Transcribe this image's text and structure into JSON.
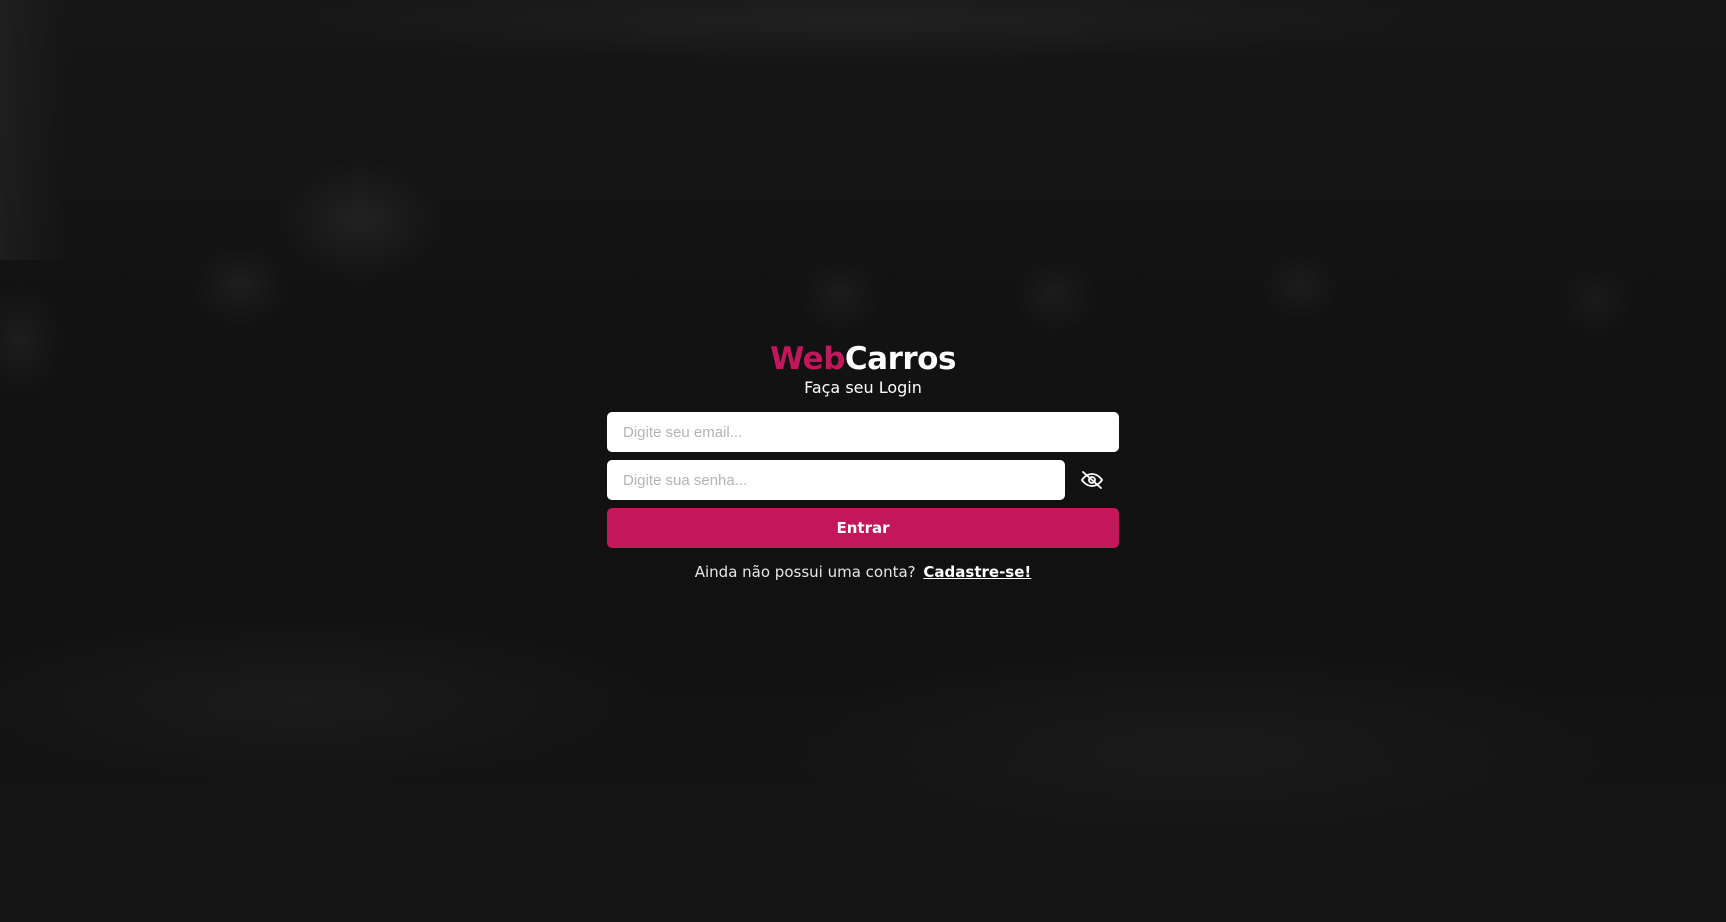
{
  "brand": {
    "part1": "Web",
    "part2": "Carros",
    "accent_color": "#c2185b"
  },
  "subtitle": "Faça seu Login",
  "form": {
    "email_placeholder": "Digite seu email...",
    "password_placeholder": "Digite sua senha...",
    "password_toggle_icon": "eye-off-icon",
    "submit_label": "Entrar"
  },
  "signup": {
    "prompt": "Ainda não possui uma conta?",
    "link_label": "Cadastre-se!"
  }
}
